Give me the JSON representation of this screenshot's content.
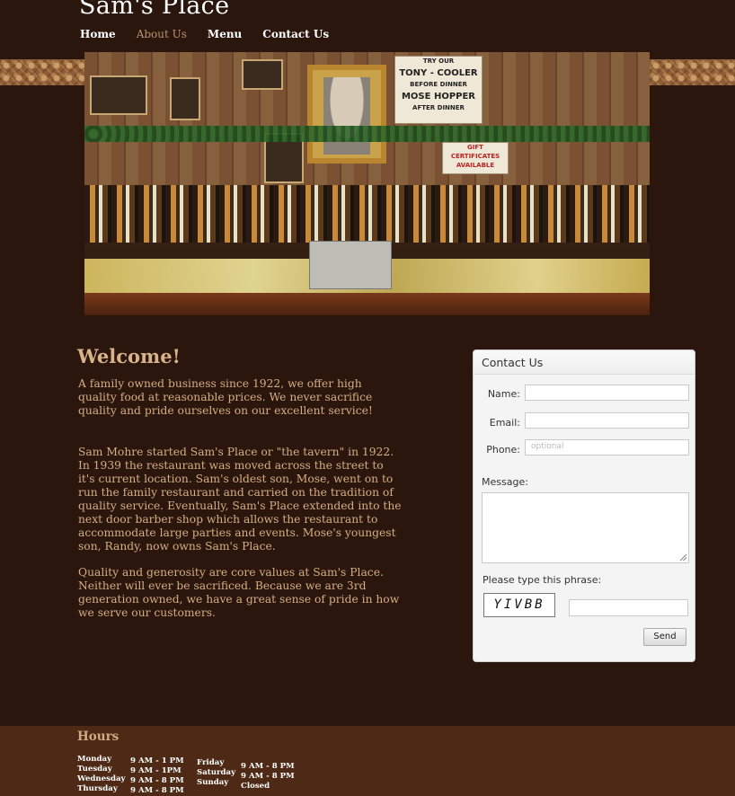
{
  "site": {
    "title": "Sam's Place"
  },
  "nav": {
    "items": [
      {
        "label": "Home",
        "active": false
      },
      {
        "label": "About Us",
        "active": true
      },
      {
        "label": "Menu",
        "active": false
      },
      {
        "label": "Contact Us",
        "active": false
      }
    ]
  },
  "hero": {
    "sign_main": [
      "TRY OUR",
      "TONY - COOLER",
      "BEFORE DINNER",
      "MOSE HOPPER",
      "AFTER DINNER"
    ],
    "sign_gift": [
      "GIFT",
      "CERTIFICATES",
      "AVAILABLE"
    ]
  },
  "welcome": {
    "title": "Welcome!",
    "paragraphs": [
      "A family owned business since 1922, we offer high quality food at reasonable prices. We never sacrifice quality and pride ourselves on our excellent service!",
      "Sam Mohre started Sam's Place or \"the tavern\" in 1922. In 1939 the restaurant was moved across the street to it's current location. Sam's oldest son, Mose, went on to run the family restaurant and carried on the tradition of quality service. Eventually, Sam's Place extended into the next door barber shop which allows the restaurant to accommodate large parties and events. Mose's youngest son, Randy, now owns Sam's Place.",
      "Quality and generosity are core values at Sam's Place. Neither will ever be sacrificed. Because we are 3rd generation owned, we have a great sense of pride in how we serve our customers."
    ]
  },
  "contact_form": {
    "title": "Contact Us",
    "name_label": "Name:",
    "email_label": "Email:",
    "phone_label": "Phone:",
    "phone_placeholder": "optional",
    "message_label": "Message:",
    "phrase_label": "Please type this phrase:",
    "captcha_text": "YIVBB",
    "send_label": "Send"
  },
  "hours": {
    "title": "Hours",
    "col1_days": [
      "Monday",
      "Tuesday",
      "Wednesday",
      "Thursday"
    ],
    "col1_times": [
      "9 AM - 1 PM",
      "9 AM - 1PM",
      "9 AM - 8 PM",
      "9 AM - 8 PM"
    ],
    "col2_days": [
      "Friday",
      "Saturday",
      "Sunday"
    ],
    "col2_times": [
      "9 AM - 8 PM",
      "9 AM - 8 PM",
      "Closed"
    ]
  }
}
